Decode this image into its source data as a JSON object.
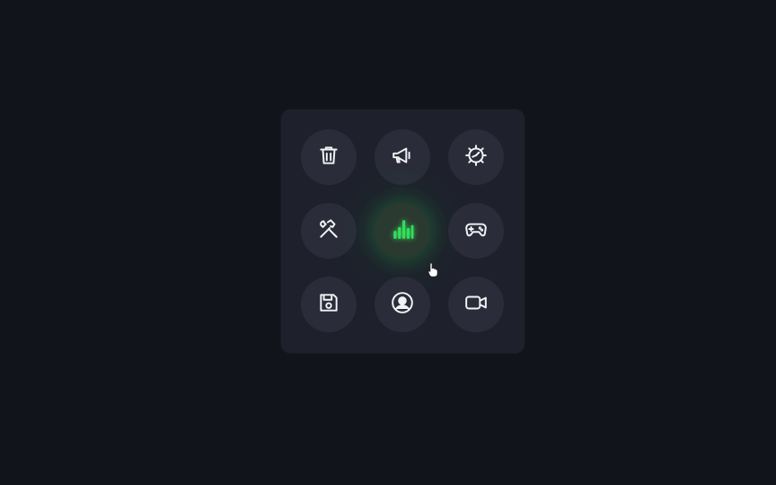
{
  "grid": {
    "active_index": 4,
    "items": [
      {
        "icon": "trash-icon"
      },
      {
        "icon": "megaphone-icon"
      },
      {
        "icon": "settings-gear-icon"
      },
      {
        "icon": "tools-icon"
      },
      {
        "icon": "bar-chart-icon"
      },
      {
        "icon": "gamepad-icon"
      },
      {
        "icon": "floppy-disk-icon"
      },
      {
        "icon": "user-profile-icon"
      },
      {
        "icon": "video-camera-icon"
      }
    ]
  },
  "colors": {
    "background": "#12141c",
    "panel": "#1e212c",
    "button": "#2a2d39",
    "icon": "#f2f3f6",
    "accent": "#2fe05a"
  }
}
